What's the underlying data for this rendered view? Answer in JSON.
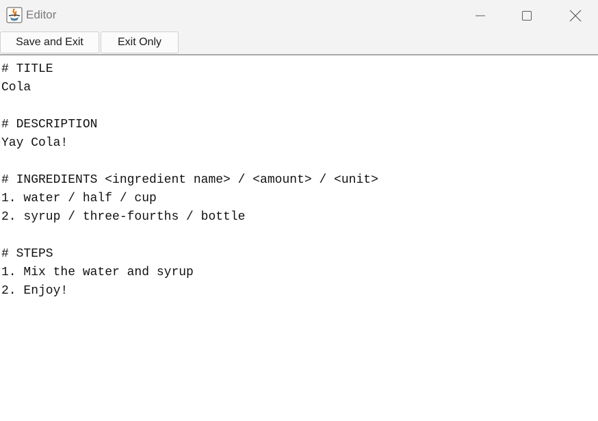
{
  "window": {
    "title": "Editor",
    "app_icon": "java-cup-icon",
    "controls": {
      "minimize_icon": "minimize-icon",
      "maximize_icon": "maximize-icon",
      "close_icon": "close-icon"
    }
  },
  "toolbar": {
    "save_and_exit_label": "Save and Exit",
    "exit_only_label": "Exit Only"
  },
  "editor": {
    "lines": [
      "# TITLE",
      "Cola",
      "",
      "# DESCRIPTION",
      "Yay Cola!",
      "",
      "# INGREDIENTS <ingredient name> / <amount> / <unit>",
      "1. water / half / cup",
      "2. syrup / three-fourths / bottle",
      "",
      "# STEPS",
      "1. Mix the water and syrup",
      "2. Enjoy!"
    ]
  }
}
